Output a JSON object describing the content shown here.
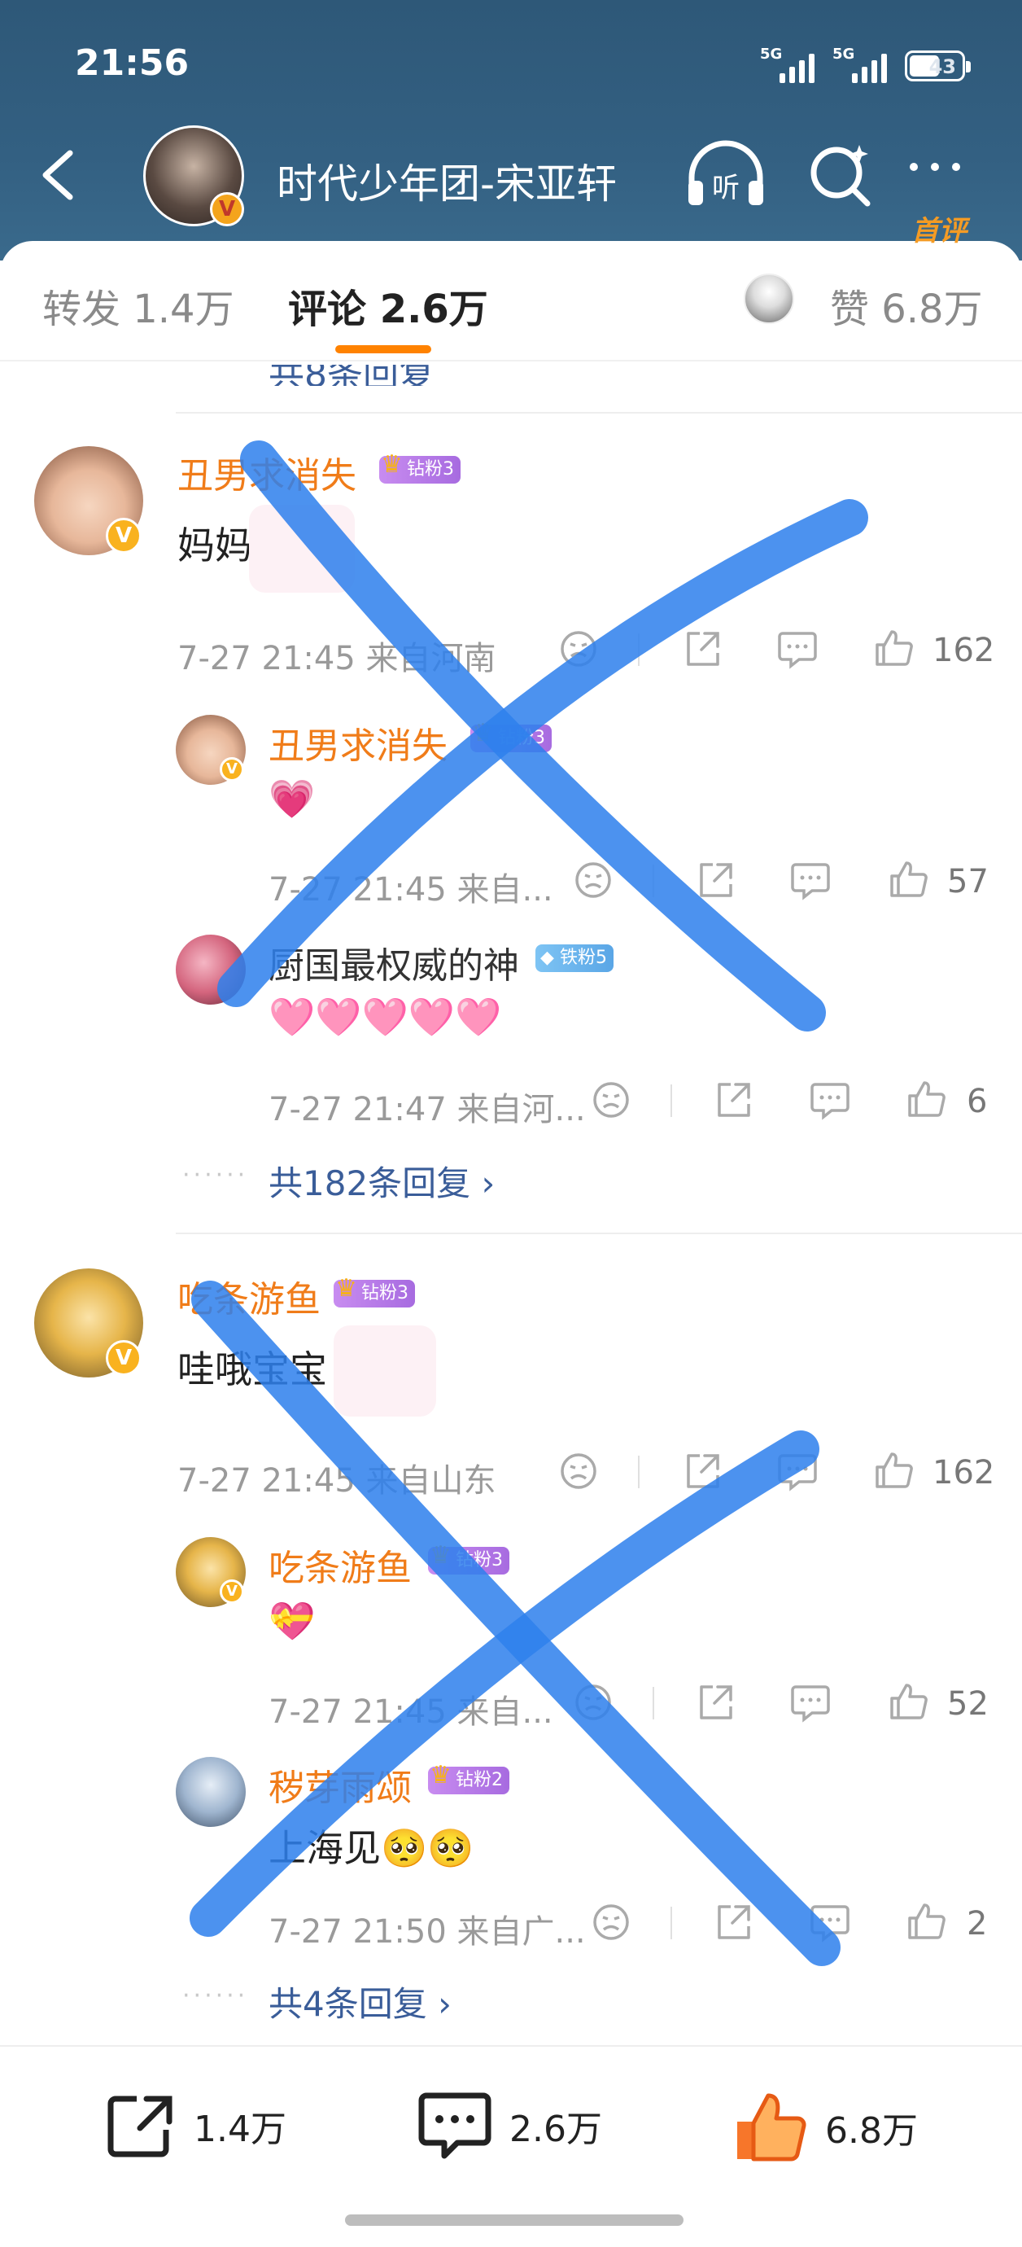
{
  "status_bar": {
    "time": "21:56",
    "signal_1": "5G",
    "signal_2": "5G",
    "battery": "43"
  },
  "nav": {
    "title": "时代少年团-宋亚轩",
    "avatar_badge": "V"
  },
  "tabs": {
    "repost": "转发 1.4万",
    "comments": "评论 2.6万",
    "likes": "赞 6.8万"
  },
  "threads": [
    {
      "username": "丑男求消失",
      "fan_badge": "钻粉3",
      "top_label": "首评",
      "content": "妈妈",
      "time_location": "7-27 21:45 来自河南",
      "likes": "162",
      "replies": [
        {
          "username": "丑男求消失",
          "fan_badge": "钻粉3",
          "content": "💗",
          "time_location": "7-27 21:45 来自...",
          "likes": "57"
        },
        {
          "username": "厨国最权威的神",
          "fan_badge": "铁粉5",
          "content": "🩷🩷🩷🩷🩷",
          "time_location": "7-27 21:47 来自河...",
          "likes": "6"
        }
      ],
      "more_replies": "共182条回复"
    },
    {
      "username": "吃条游鱼",
      "fan_badge": "钻粉3",
      "content": "哇哦宝宝",
      "time_location": "7-27 21:45 来自山东",
      "likes": "162",
      "replies": [
        {
          "username": "吃条游鱼",
          "fan_badge": "钻粉3",
          "content": "💝",
          "time_location": "7-27 21:45 来自...",
          "likes": "52"
        },
        {
          "username": "秽芽雨颂",
          "fan_badge": "钻粉2",
          "content": "上海见🥺🥺",
          "time_location": "7-27 21:50 来自广...",
          "likes": "2"
        }
      ],
      "more_replies": "共4条回复"
    }
  ],
  "bottom_bar": {
    "repost": "1.4万",
    "comment": "2.6万",
    "like": "6.8万"
  },
  "colors": {
    "header": "#336082",
    "accent": "#ff8200",
    "username": "#f07c19",
    "link": "#3a5d99",
    "scribble": "#2f80ec"
  }
}
